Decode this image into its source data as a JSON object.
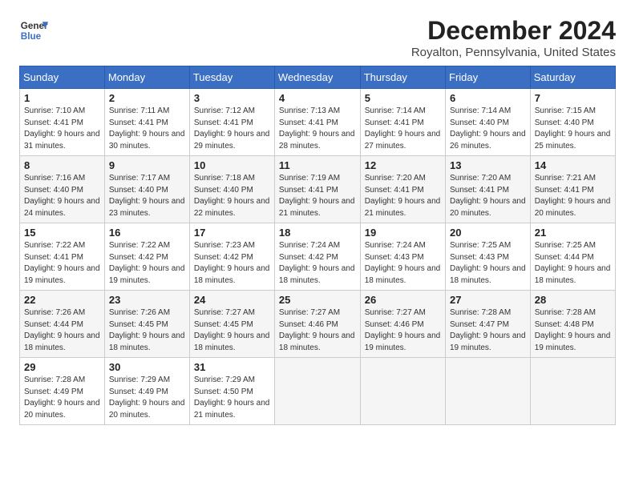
{
  "header": {
    "logo_line1": "General",
    "logo_line2": "Blue",
    "month": "December 2024",
    "location": "Royalton, Pennsylvania, United States"
  },
  "weekdays": [
    "Sunday",
    "Monday",
    "Tuesday",
    "Wednesday",
    "Thursday",
    "Friday",
    "Saturday"
  ],
  "weeks": [
    [
      {
        "day": "1",
        "sunrise": "Sunrise: 7:10 AM",
        "sunset": "Sunset: 4:41 PM",
        "daylight": "Daylight: 9 hours and 31 minutes."
      },
      {
        "day": "2",
        "sunrise": "Sunrise: 7:11 AM",
        "sunset": "Sunset: 4:41 PM",
        "daylight": "Daylight: 9 hours and 30 minutes."
      },
      {
        "day": "3",
        "sunrise": "Sunrise: 7:12 AM",
        "sunset": "Sunset: 4:41 PM",
        "daylight": "Daylight: 9 hours and 29 minutes."
      },
      {
        "day": "4",
        "sunrise": "Sunrise: 7:13 AM",
        "sunset": "Sunset: 4:41 PM",
        "daylight": "Daylight: 9 hours and 28 minutes."
      },
      {
        "day": "5",
        "sunrise": "Sunrise: 7:14 AM",
        "sunset": "Sunset: 4:41 PM",
        "daylight": "Daylight: 9 hours and 27 minutes."
      },
      {
        "day": "6",
        "sunrise": "Sunrise: 7:14 AM",
        "sunset": "Sunset: 4:40 PM",
        "daylight": "Daylight: 9 hours and 26 minutes."
      },
      {
        "day": "7",
        "sunrise": "Sunrise: 7:15 AM",
        "sunset": "Sunset: 4:40 PM",
        "daylight": "Daylight: 9 hours and 25 minutes."
      }
    ],
    [
      {
        "day": "8",
        "sunrise": "Sunrise: 7:16 AM",
        "sunset": "Sunset: 4:40 PM",
        "daylight": "Daylight: 9 hours and 24 minutes."
      },
      {
        "day": "9",
        "sunrise": "Sunrise: 7:17 AM",
        "sunset": "Sunset: 4:40 PM",
        "daylight": "Daylight: 9 hours and 23 minutes."
      },
      {
        "day": "10",
        "sunrise": "Sunrise: 7:18 AM",
        "sunset": "Sunset: 4:40 PM",
        "daylight": "Daylight: 9 hours and 22 minutes."
      },
      {
        "day": "11",
        "sunrise": "Sunrise: 7:19 AM",
        "sunset": "Sunset: 4:41 PM",
        "daylight": "Daylight: 9 hours and 21 minutes."
      },
      {
        "day": "12",
        "sunrise": "Sunrise: 7:20 AM",
        "sunset": "Sunset: 4:41 PM",
        "daylight": "Daylight: 9 hours and 21 minutes."
      },
      {
        "day": "13",
        "sunrise": "Sunrise: 7:20 AM",
        "sunset": "Sunset: 4:41 PM",
        "daylight": "Daylight: 9 hours and 20 minutes."
      },
      {
        "day": "14",
        "sunrise": "Sunrise: 7:21 AM",
        "sunset": "Sunset: 4:41 PM",
        "daylight": "Daylight: 9 hours and 20 minutes."
      }
    ],
    [
      {
        "day": "15",
        "sunrise": "Sunrise: 7:22 AM",
        "sunset": "Sunset: 4:41 PM",
        "daylight": "Daylight: 9 hours and 19 minutes."
      },
      {
        "day": "16",
        "sunrise": "Sunrise: 7:22 AM",
        "sunset": "Sunset: 4:42 PM",
        "daylight": "Daylight: 9 hours and 19 minutes."
      },
      {
        "day": "17",
        "sunrise": "Sunrise: 7:23 AM",
        "sunset": "Sunset: 4:42 PM",
        "daylight": "Daylight: 9 hours and 18 minutes."
      },
      {
        "day": "18",
        "sunrise": "Sunrise: 7:24 AM",
        "sunset": "Sunset: 4:42 PM",
        "daylight": "Daylight: 9 hours and 18 minutes."
      },
      {
        "day": "19",
        "sunrise": "Sunrise: 7:24 AM",
        "sunset": "Sunset: 4:43 PM",
        "daylight": "Daylight: 9 hours and 18 minutes."
      },
      {
        "day": "20",
        "sunrise": "Sunrise: 7:25 AM",
        "sunset": "Sunset: 4:43 PM",
        "daylight": "Daylight: 9 hours and 18 minutes."
      },
      {
        "day": "21",
        "sunrise": "Sunrise: 7:25 AM",
        "sunset": "Sunset: 4:44 PM",
        "daylight": "Daylight: 9 hours and 18 minutes."
      }
    ],
    [
      {
        "day": "22",
        "sunrise": "Sunrise: 7:26 AM",
        "sunset": "Sunset: 4:44 PM",
        "daylight": "Daylight: 9 hours and 18 minutes."
      },
      {
        "day": "23",
        "sunrise": "Sunrise: 7:26 AM",
        "sunset": "Sunset: 4:45 PM",
        "daylight": "Daylight: 9 hours and 18 minutes."
      },
      {
        "day": "24",
        "sunrise": "Sunrise: 7:27 AM",
        "sunset": "Sunset: 4:45 PM",
        "daylight": "Daylight: 9 hours and 18 minutes."
      },
      {
        "day": "25",
        "sunrise": "Sunrise: 7:27 AM",
        "sunset": "Sunset: 4:46 PM",
        "daylight": "Daylight: 9 hours and 18 minutes."
      },
      {
        "day": "26",
        "sunrise": "Sunrise: 7:27 AM",
        "sunset": "Sunset: 4:46 PM",
        "daylight": "Daylight: 9 hours and 19 minutes."
      },
      {
        "day": "27",
        "sunrise": "Sunrise: 7:28 AM",
        "sunset": "Sunset: 4:47 PM",
        "daylight": "Daylight: 9 hours and 19 minutes."
      },
      {
        "day": "28",
        "sunrise": "Sunrise: 7:28 AM",
        "sunset": "Sunset: 4:48 PM",
        "daylight": "Daylight: 9 hours and 19 minutes."
      }
    ],
    [
      {
        "day": "29",
        "sunrise": "Sunrise: 7:28 AM",
        "sunset": "Sunset: 4:49 PM",
        "daylight": "Daylight: 9 hours and 20 minutes."
      },
      {
        "day": "30",
        "sunrise": "Sunrise: 7:29 AM",
        "sunset": "Sunset: 4:49 PM",
        "daylight": "Daylight: 9 hours and 20 minutes."
      },
      {
        "day": "31",
        "sunrise": "Sunrise: 7:29 AM",
        "sunset": "Sunset: 4:50 PM",
        "daylight": "Daylight: 9 hours and 21 minutes."
      },
      null,
      null,
      null,
      null
    ]
  ]
}
